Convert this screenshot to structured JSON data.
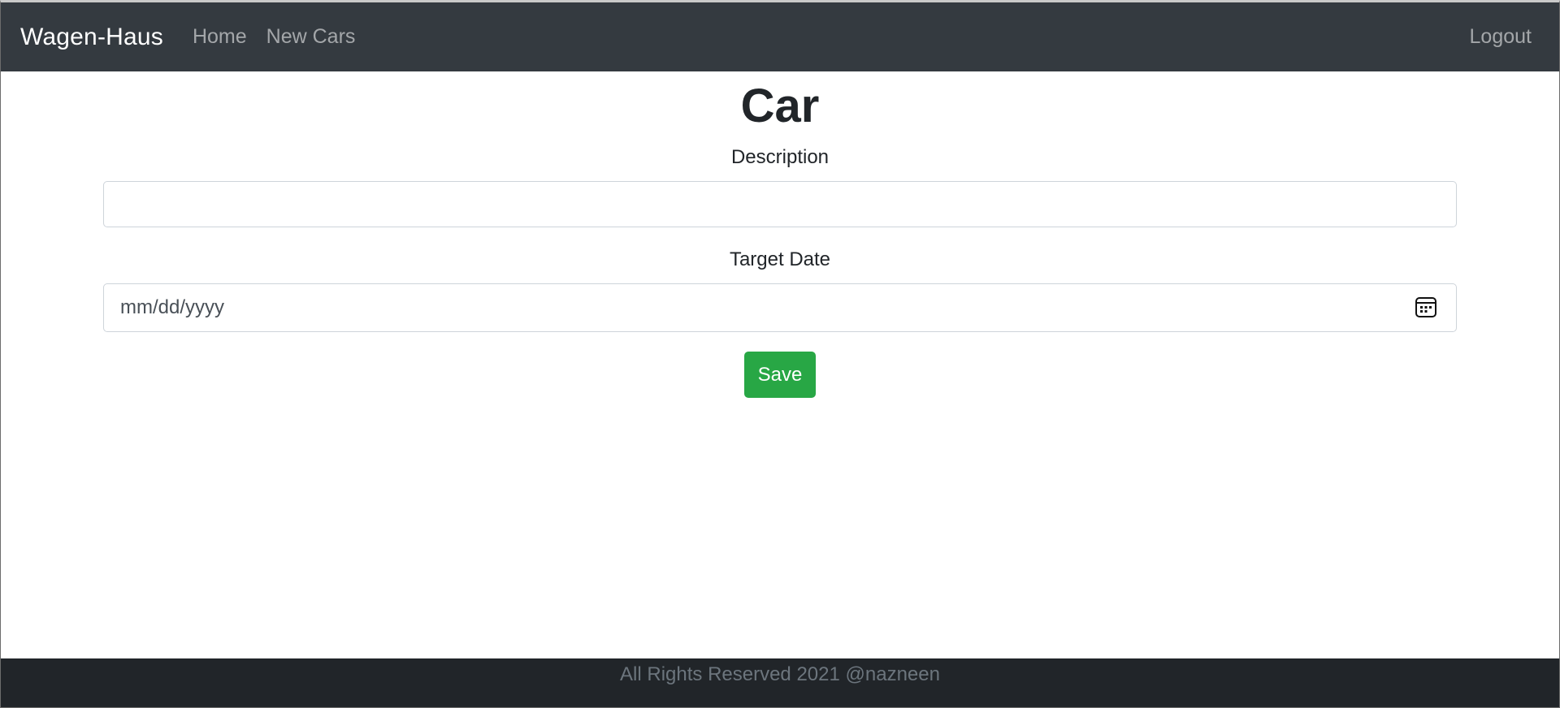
{
  "navbar": {
    "brand": "Wagen-Haus",
    "links": [
      "Home",
      "New Cars"
    ],
    "logout": "Logout"
  },
  "page": {
    "title": "Car"
  },
  "form": {
    "description_label": "Description",
    "description_value": "",
    "target_date_label": "Target Date",
    "target_date_placeholder": "mm/dd/yyyy",
    "save_label": "Save"
  },
  "footer": {
    "text": "All Rights Reserved 2021 @nazneen"
  },
  "colors": {
    "navbar_bg": "#343a40",
    "save_button": "#28a745",
    "footer_bg": "#212529"
  },
  "icons": {
    "date_picker": "calendar-icon"
  }
}
